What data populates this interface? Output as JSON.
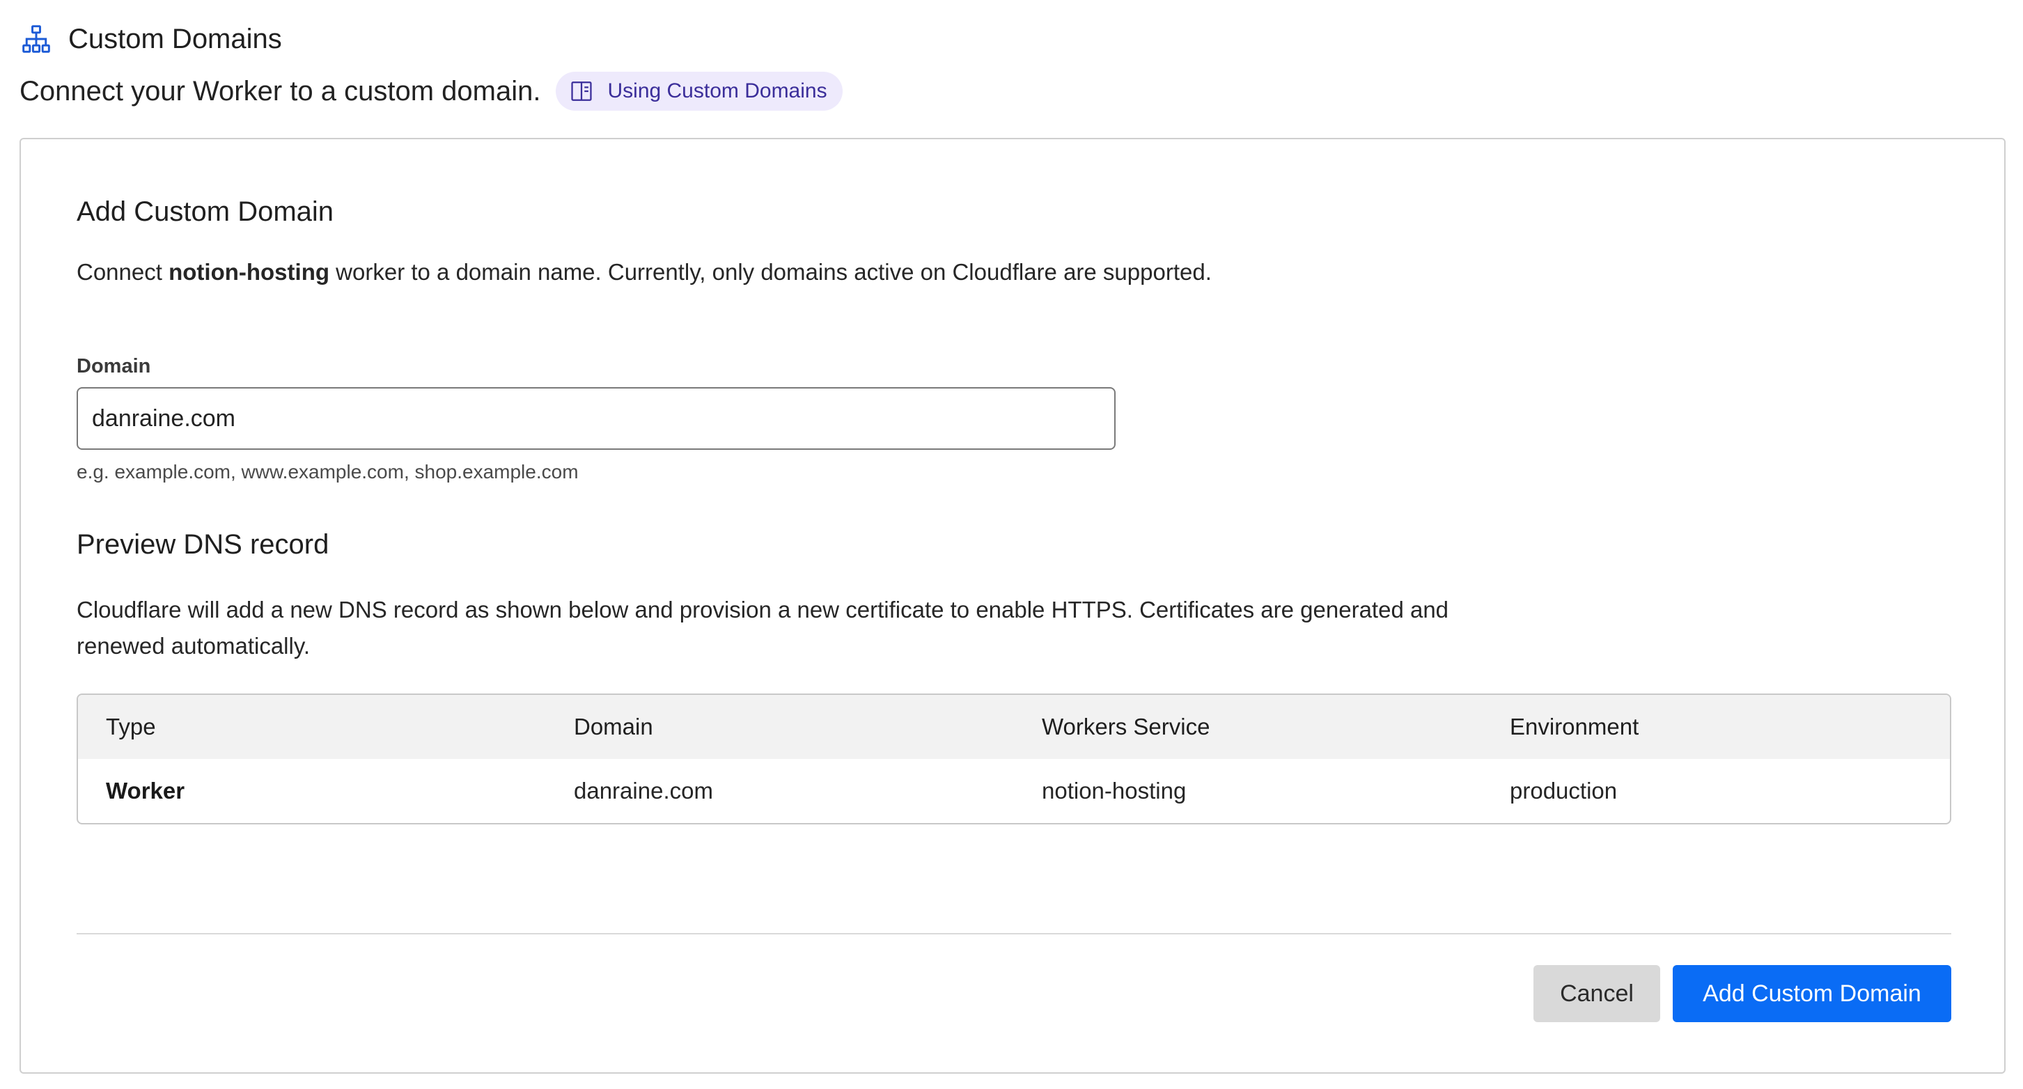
{
  "header": {
    "icon": "sitemap-icon",
    "title": "Custom Domains",
    "subtitle": "Connect your Worker to a custom domain.",
    "docs_link": {
      "icon": "book-icon",
      "label": "Using Custom Domains"
    }
  },
  "card": {
    "title": "Add Custom Domain",
    "desc_prefix": "Connect ",
    "worker_name": "notion-hosting",
    "desc_suffix": " worker to a domain name. Currently, only domains active on Cloudflare are supported.",
    "domain_field": {
      "label": "Domain",
      "value": "danraine.com",
      "hint": "e.g. example.com, www.example.com, shop.example.com"
    },
    "preview": {
      "title": "Preview DNS record",
      "description": "Cloudflare will add a new DNS record as shown below and provision a new certificate to enable HTTPS. Certificates are generated and renewed automatically.",
      "columns": [
        "Type",
        "Domain",
        "Workers Service",
        "Environment"
      ],
      "row": [
        "Worker",
        "danraine.com",
        "notion-hosting",
        "production"
      ]
    },
    "buttons": {
      "cancel": "Cancel",
      "submit": "Add Custom Domain"
    }
  },
  "colors": {
    "accent": "#0a6cf5",
    "pill_bg": "#eeeafc",
    "pill_text": "#3b2e9a",
    "icon": "#1d5bd6"
  }
}
